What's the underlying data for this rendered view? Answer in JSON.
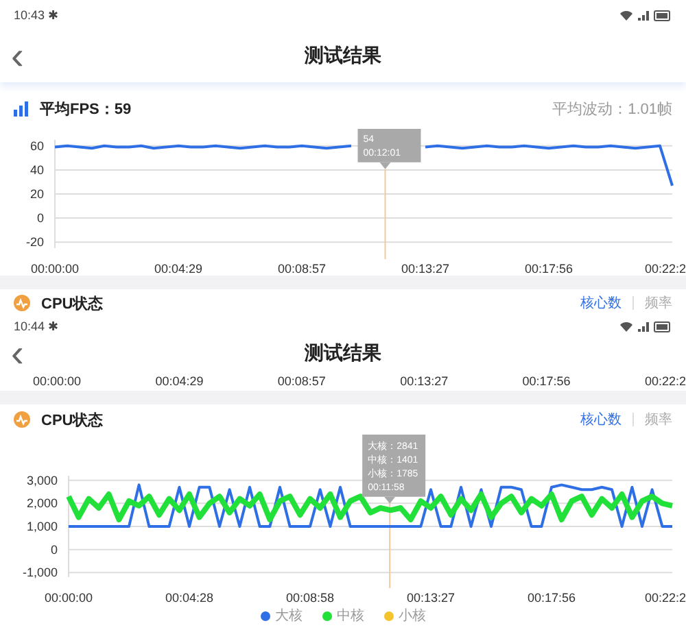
{
  "screens": [
    {
      "status_bar": {
        "time": "10:43",
        "bt": "✱"
      },
      "nav": {
        "back": "‹",
        "title": "测试结果"
      },
      "fps": {
        "title": "平均FPS：59",
        "fluctuation": "平均波动：1.01帧",
        "chart_data": {
          "type": "line",
          "grid": true,
          "ylim": [
            -25,
            65
          ],
          "yticks": [
            -20,
            0,
            20,
            40,
            60
          ],
          "categories": [
            "00:00:00",
            null,
            null,
            null,
            null,
            null,
            null,
            null,
            null,
            null,
            "00:04:29",
            null,
            null,
            null,
            null,
            null,
            null,
            null,
            null,
            null,
            "00:08:57",
            null,
            null,
            null,
            null,
            null,
            null,
            null,
            null,
            null,
            "00:13:27",
            null,
            null,
            null,
            null,
            null,
            null,
            null,
            null,
            null,
            "00:17:56",
            null,
            null,
            null,
            null,
            null,
            null,
            null,
            null,
            null,
            "00:22:2"
          ],
          "series": [
            {
              "color": "#2f6fe6",
              "values": [
                59,
                60,
                59,
                58,
                60,
                59,
                59,
                60,
                58,
                59,
                60,
                59,
                59,
                60,
                59,
                58,
                59,
                60,
                59,
                59,
                60,
                59,
                58,
                59,
                60,
                null,
                null,
                null,
                null,
                null,
                59,
                60,
                59,
                58,
                59,
                60,
                59,
                59,
                60,
                59,
                58,
                59,
                60,
                59,
                59,
                60,
                59,
                58,
                59,
                60,
                27
              ]
            }
          ]
        },
        "tooltip": [
          "54",
          "00:12:01"
        ]
      },
      "cpu_header": {
        "title": "CPU状态",
        "tabs": [
          {
            "label": "核心数",
            "selected": true
          },
          {
            "label": "频率",
            "selected": false
          }
        ]
      }
    },
    {
      "status_bar": {
        "time": "10:44",
        "bt": "✱"
      },
      "nav": {
        "back": "‹",
        "title": "测试结果"
      },
      "axis_labels": [
        "00:00:00",
        "00:04:29",
        "00:08:57",
        "00:13:27",
        "00:17:56",
        "00:22:2"
      ],
      "cpu_header": {
        "title": "CPU状态",
        "tabs": [
          {
            "label": "核心数",
            "selected": true
          },
          {
            "label": "频率",
            "selected": false
          }
        ]
      },
      "cpu": {
        "chart_data": {
          "type": "line",
          "grid": true,
          "ylim": [
            -1200,
            3200
          ],
          "yticks": [
            {
              "value": 3000,
              "label": "3,000"
            },
            {
              "value": 2000,
              "label": "2,000"
            },
            {
              "value": 1000,
              "label": "1,000"
            },
            {
              "value": 0,
              "label": "0"
            },
            {
              "value": -1000,
              "label": "-1,000"
            }
          ],
          "categories": [
            "00:00:00",
            null,
            null,
            null,
            null,
            null,
            null,
            null,
            null,
            null,
            null,
            null,
            "00:04:28",
            null,
            null,
            null,
            null,
            null,
            null,
            null,
            null,
            null,
            null,
            null,
            "00:08:58",
            null,
            null,
            null,
            null,
            null,
            null,
            null,
            null,
            null,
            null,
            null,
            "00:13:27",
            null,
            null,
            null,
            null,
            null,
            null,
            null,
            null,
            null,
            null,
            null,
            "00:17:56",
            null,
            null,
            null,
            null,
            null,
            null,
            null,
            null,
            null,
            null,
            null,
            "00:22:2"
          ],
          "series": [
            {
              "name": "大核",
              "color": "#2f6fe6",
              "values": [
                1000,
                1000,
                1000,
                1000,
                1000,
                1000,
                1000,
                2800,
                1000,
                1000,
                1000,
                2700,
                1000,
                2700,
                2700,
                1000,
                2600,
                1000,
                2700,
                1000,
                1000,
                2700,
                1000,
                1000,
                1000,
                2600,
                1000,
                2700,
                1000,
                1000,
                1000,
                1000,
                1000,
                1000,
                1000,
                1000,
                2600,
                1000,
                1000,
                2700,
                1000,
                2600,
                1000,
                2700,
                2700,
                2600,
                1000,
                1000,
                2700,
                2800,
                2700,
                2600,
                2600,
                2700,
                2600,
                1000,
                2700,
                1000,
                2600,
                1000,
                1000
              ]
            },
            {
              "name": "中核",
              "color": "#22e03a",
              "values": [
                2300,
                1400,
                2200,
                1800,
                2400,
                1300,
                2100,
                1900,
                2300,
                1500,
                2200,
                1700,
                2400,
                1400,
                2000,
                2300,
                1600,
                2200,
                1900,
                2400,
                1300,
                2100,
                2300,
                1500,
                2200,
                1800,
                2400,
                1400,
                2100,
                2300,
                1600,
                1800,
                1700,
                1800,
                1300,
                2100,
                1800,
                2300,
                1500,
                2200,
                1700,
                2400,
                1400,
                2000,
                2300,
                1600,
                2200,
                1900,
                2400,
                1300,
                2100,
                2300,
                1500,
                2200,
                1800,
                2400,
                1400,
                2100,
                2300,
                2000,
                1900
              ]
            },
            {
              "name": "小核",
              "color": "#f5c42c",
              "values": [
                null,
                null,
                null,
                null,
                null,
                null,
                null,
                null,
                null,
                null,
                null,
                null,
                null,
                null,
                null,
                null,
                null,
                null,
                null,
                null,
                null,
                null,
                null,
                null,
                null,
                null,
                null,
                null,
                null,
                null,
                null,
                null,
                null,
                null,
                null,
                null,
                null,
                null,
                null,
                null,
                null,
                null,
                null,
                null,
                null,
                null,
                null,
                null,
                null,
                null,
                null,
                null,
                null,
                null,
                null,
                null,
                null,
                null,
                null,
                null,
                null
              ]
            }
          ]
        },
        "tooltip": [
          "大核：2841",
          "中核：1401",
          "小核：1785",
          "00:11:58"
        ]
      }
    }
  ]
}
